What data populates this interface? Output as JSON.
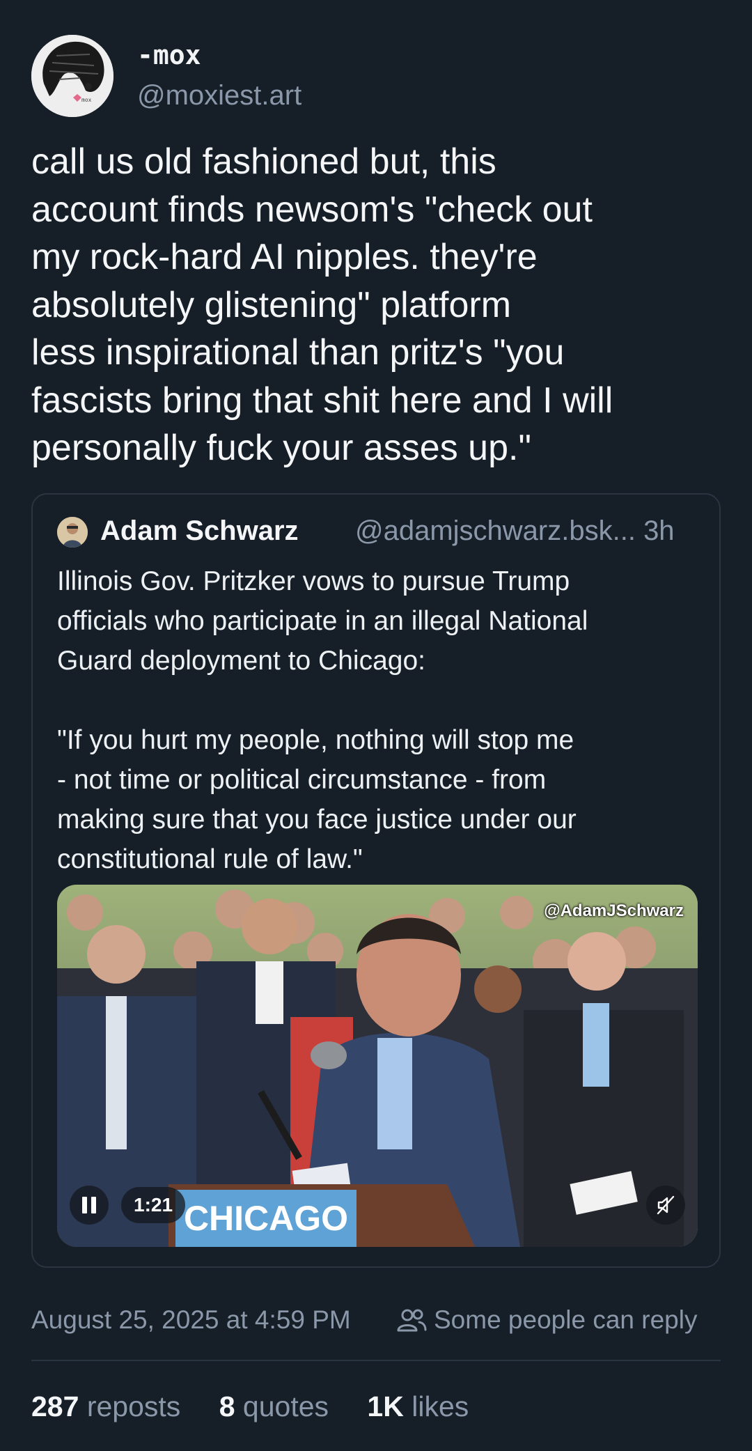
{
  "author": {
    "display_name": "-mox",
    "handle": "@moxiest.art"
  },
  "post": {
    "text": "call us old fashioned but, this\naccount finds newsom's \"check out\nmy rock-hard AI nipples. they're\nabsolutely glistening\" platform\nless inspirational than pritz's \"you\nfascists bring that shit here and I will\npersonally fuck your asses up.\""
  },
  "quote": {
    "name": "Adam Schwarz",
    "handle_time": "@adamjschwarz.bsk... 3h",
    "text": "Illinois Gov. Pritzker vows to pursue Trump\nofficials who participate in an illegal National\nGuard deployment to Chicago:\n\n\"If you hurt my people, nothing will stop me\n- not time or political circumstance - from\nmaking sure that you face justice under our\nconstitutional rule of law.\"",
    "video": {
      "watermark": "@AdamJSchwarz",
      "duration": "1:21",
      "podium_sign": "CHICAGO",
      "paused": false,
      "muted": true
    }
  },
  "meta": {
    "timestamp": "August 25, 2025 at 4:59 PM",
    "reply_setting": "Some people can reply"
  },
  "stats": {
    "reposts_count": "287",
    "reposts_label": "reposts",
    "quotes_count": "8",
    "quotes_label": "quotes",
    "likes_count": "1K",
    "likes_label": "likes"
  },
  "colors": {
    "background": "#161e27",
    "text_primary": "#f4f6f8",
    "text_secondary": "#8a98aa",
    "border": "#2a3542"
  }
}
